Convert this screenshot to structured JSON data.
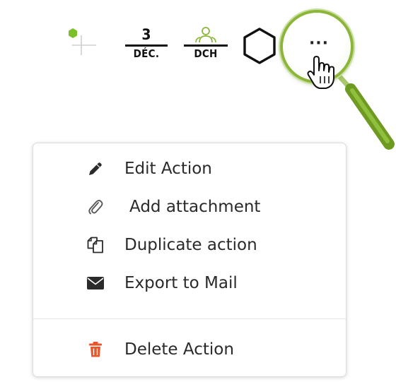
{
  "toolbar": {
    "date_fraction": {
      "numerator": "3",
      "denominator": "DÉC."
    },
    "dch_fraction": {
      "denominator": "DCH"
    },
    "more_label": "···"
  },
  "menu": {
    "items": [
      {
        "label": "Edit Action",
        "icon": "pencil-icon"
      },
      {
        "label": "Add attachment",
        "icon": "paperclip-icon"
      },
      {
        "label": "Duplicate action",
        "icon": "duplicate-icon"
      },
      {
        "label": "Export to Mail",
        "icon": "envelope-icon"
      }
    ],
    "delete_item": {
      "label": "Delete Action",
      "icon": "trash-icon"
    }
  },
  "colors": {
    "accent_green": "#8bb63a",
    "delete_orange": "#e8552a",
    "text": "#2a2a2a"
  }
}
